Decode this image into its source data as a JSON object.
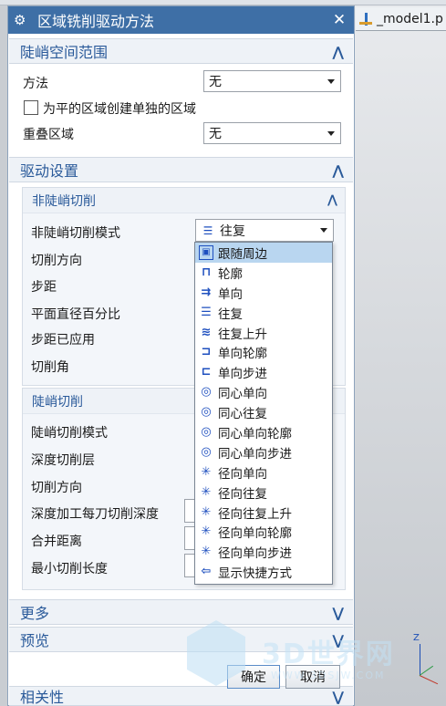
{
  "window": {
    "title": "区域铣削驱动方法",
    "model_tab": "_model1.p"
  },
  "steep_space": {
    "header": "陡峭空间范围",
    "method_label": "方法",
    "method_value": "无",
    "separate_regions_label": "为平的区域创建单独的区域",
    "separate_regions_checked": false,
    "overlap_label": "重叠区域",
    "overlap_value": "无"
  },
  "drive_settings": {
    "header": "驱动设置",
    "non_steep": {
      "header": "非陡峭切削",
      "mode_label": "非陡峭切削模式",
      "mode_value": "往复",
      "cut_direction_label": "切削方向",
      "stepover_label": "步距",
      "flat_diameter_pct_label": "平面直径百分比",
      "stepover_applied_label": "步距已应用",
      "cut_angle_label": "切削角"
    },
    "steep": {
      "header": "陡峭切削",
      "mode_label": "陡峭切削模式",
      "depth_layer_label": "深度切削层",
      "cut_direction_label": "切削方向",
      "depth_per_cut_label": "深度加工每刀切削深度",
      "merge_distance_label": "合并距离",
      "min_cut_length_label": "最小切削长度"
    }
  },
  "dropdown": {
    "items": [
      {
        "label": "跟随周边",
        "icon": "follow-periphery-icon",
        "glyph": "▣",
        "selected": true
      },
      {
        "label": "轮廓",
        "icon": "profile-icon",
        "glyph": "⊓",
        "selected": false
      },
      {
        "label": "单向",
        "icon": "zig-icon",
        "glyph": "⇉",
        "selected": false
      },
      {
        "label": "往复",
        "icon": "zig-zag-icon",
        "glyph": "☰",
        "selected": false
      },
      {
        "label": "往复上升",
        "icon": "zig-zag-lift-icon",
        "glyph": "≋",
        "selected": false
      },
      {
        "label": "单向轮廓",
        "icon": "zig-with-contour-icon",
        "glyph": "⊐",
        "selected": false
      },
      {
        "label": "单向步进",
        "icon": "zig-with-step-icon",
        "glyph": "⊏",
        "selected": false
      },
      {
        "label": "同心单向",
        "icon": "concentric-zig-icon",
        "glyph": "◎",
        "selected": false
      },
      {
        "label": "同心往复",
        "icon": "concentric-zig-zag-icon",
        "glyph": "◎",
        "selected": false
      },
      {
        "label": "同心单向轮廓",
        "icon": "concentric-zig-contour-icon",
        "glyph": "◎",
        "selected": false
      },
      {
        "label": "同心单向步进",
        "icon": "concentric-zig-step-icon",
        "glyph": "◎",
        "selected": false
      },
      {
        "label": "径向单向",
        "icon": "radial-zig-icon",
        "glyph": "✳",
        "selected": false
      },
      {
        "label": "径向往复",
        "icon": "radial-zig-zag-icon",
        "glyph": "✳",
        "selected": false
      },
      {
        "label": "径向往复上升",
        "icon": "radial-zig-zag-lift-icon",
        "glyph": "✳",
        "selected": false
      },
      {
        "label": "径向单向轮廓",
        "icon": "radial-zig-contour-icon",
        "glyph": "✳",
        "selected": false
      },
      {
        "label": "径向单向步进",
        "icon": "radial-zig-step-icon",
        "glyph": "✳",
        "selected": false
      },
      {
        "label": "显示快捷方式",
        "icon": "show-shortcuts-icon",
        "glyph": "⇦",
        "selected": false
      }
    ]
  },
  "more": {
    "header": "更多"
  },
  "preview": {
    "header": "预览"
  },
  "related": {
    "header": "相关性"
  },
  "buttons": {
    "ok": "确定",
    "cancel": "取消"
  },
  "watermark": {
    "text": "3D世界网",
    "url": "WWW.3DSJW.COM"
  },
  "triad": {
    "z_label": "Z"
  },
  "colors": {
    "titlebar": "#3e6fa6",
    "accent": "#2a5a9a",
    "selected_item": "#b9d6f0"
  }
}
